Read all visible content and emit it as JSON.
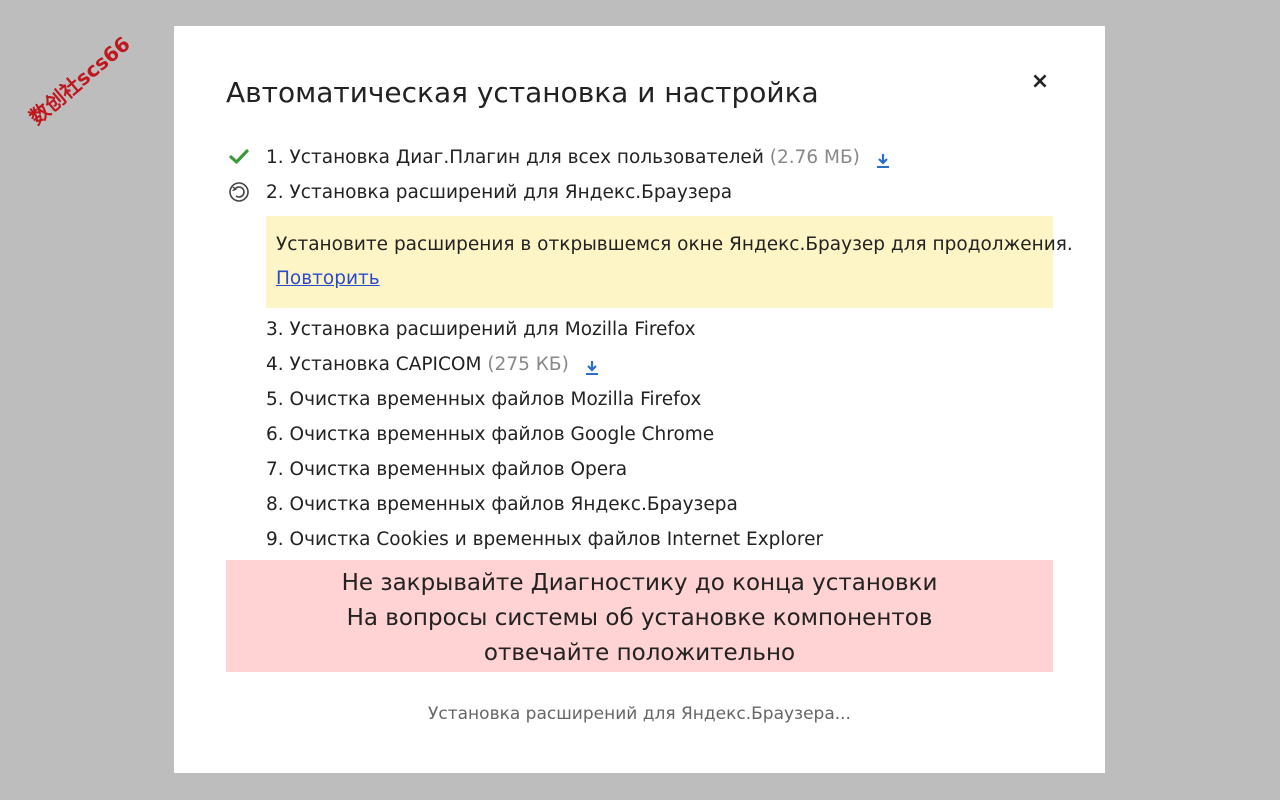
{
  "watermark": "数创社scs66",
  "dialog": {
    "title": "Автоматическая установка и настройка",
    "close_label": "×"
  },
  "steps": [
    {
      "label": "1. Установка Диаг.Плагин для всех пользователей",
      "size": "(2.76 МБ)",
      "status": "done",
      "download": true
    },
    {
      "label": "2. Установка расширений для Яндекс.Браузера",
      "size": "",
      "status": "in-progress",
      "download": false
    },
    {
      "label": "3. Установка расширений для Mozilla Firefox",
      "size": "",
      "status": "pending",
      "download": false
    },
    {
      "label": "4. Установка CAPICOM",
      "size": "(275 КБ)",
      "status": "pending",
      "download": true
    },
    {
      "label": "5. Очистка временных файлов Mozilla Firefox",
      "size": "",
      "status": "pending",
      "download": false
    },
    {
      "label": "6. Очистка временных файлов Google Chrome",
      "size": "",
      "status": "pending",
      "download": false
    },
    {
      "label": "7. Очистка временных файлов Opera",
      "size": "",
      "status": "pending",
      "download": false
    },
    {
      "label": "8. Очистка временных файлов Яндекс.Браузера",
      "size": "",
      "status": "pending",
      "download": false
    },
    {
      "label": "9. Очистка Cookies и временных файлов Internet Explorer",
      "size": "",
      "status": "pending",
      "download": false
    }
  ],
  "notice": {
    "message": "Установите расширения в открывшемся окне Яндекс.Браузер для продолжения.",
    "retry_label": "Повторить"
  },
  "warning": {
    "line1": "Не закрывайте Диагностику до конца установки",
    "line2": "На вопросы системы об установке компонентов",
    "line3": "отвечайте положительно"
  },
  "status_text": "Установка расширений для Яндекс.Браузера...",
  "colors": {
    "check": "#3a9a3a",
    "download": "#2a6fc9",
    "notice_bg": "#fdf5c6",
    "warning_bg": "#ffd2d3",
    "link": "#2b4acb"
  }
}
